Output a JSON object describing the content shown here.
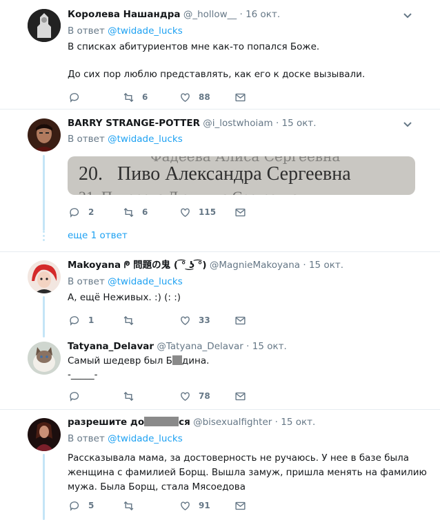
{
  "tweets": [
    {
      "name": "Королева Нашандра",
      "handle": "@_hollow__",
      "sep": "·",
      "time": "16 окт.",
      "reply_prefix": "В ответ",
      "reply_to": "@twidade_lucks",
      "lines": [
        "В списках абитуриентов мне как-то попался Боже.",
        "До сих пор люблю представлять, как его к доске вызывали."
      ],
      "replies": "",
      "retweets": "6",
      "likes": "88"
    },
    {
      "name": "BARRY STRANGE-POTTER",
      "handle": "@i_lostwhoiam",
      "sep": "·",
      "time": "15 окт.",
      "reply_prefix": "В ответ",
      "reply_to": "@twidade_lucks",
      "image_text": "20.   Пиво Александра Сергеевна",
      "replies": "2",
      "retweets": "6",
      "likes": "115",
      "more": "еще 1 ответ"
    },
    {
      "name": "Makoyana ᖘ 問題の鬼 ( ͡° ͜ʖ ͡°)",
      "handle": "@MagnieMakoyana",
      "sep": "·",
      "time": "15 окт.",
      "reply_prefix": "В ответ",
      "reply_to": "@twidade_lucks",
      "lines": [
        "А, ещё Неживых. :) (: :)"
      ],
      "replies": "1",
      "retweets": "",
      "likes": "33"
    },
    {
      "name": "Tatyana_Delavar",
      "handle": "@Tatyana_Delavar",
      "sep": "·",
      "time": "15 окт.",
      "text_a": "Самый шедевр был Б",
      "text_b": "дина.",
      "line2": "-_____-",
      "replies": "",
      "retweets": "",
      "likes": "78"
    },
    {
      "name_a": "разрешите до",
      "name_b": "ся",
      "handle": "@bisexualfighter",
      "sep": "·",
      "time": "15 окт.",
      "reply_prefix": "В ответ",
      "reply_to": "@twidade_lucks",
      "lines": [
        "Рассказывала мама, за достоверность не ручаюсь. У нее в базе была",
        "женщина с фамилией Борщ. Вышла замуж, пришла менять на фамилию",
        "мужа. Была Борщ, стала Мясоедова"
      ],
      "replies": "5",
      "retweets": "",
      "likes": "91"
    }
  ]
}
